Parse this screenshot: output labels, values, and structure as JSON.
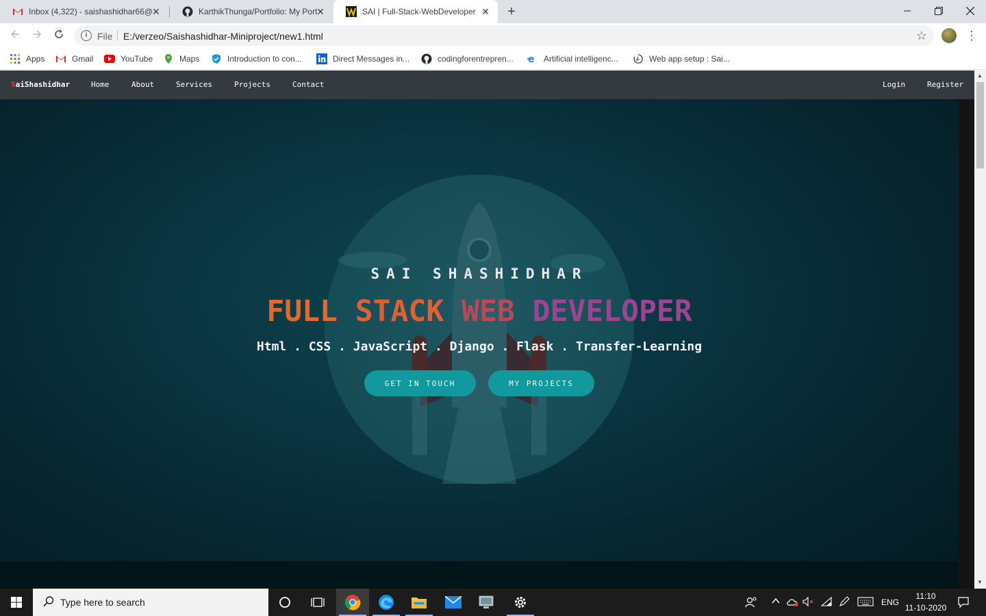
{
  "browser": {
    "tabs": [
      {
        "title": "Inbox (4,322) - saishashidhar66@",
        "icon": "gmail-icon"
      },
      {
        "title": "KarthikThunga/Portfolio: My Port",
        "icon": "github-icon"
      },
      {
        "title": "SAI | Full-Stack-WebDeveloper",
        "icon": "site-icon",
        "active": true
      }
    ],
    "new_tab": "+",
    "address": {
      "scheme": "File",
      "url": "E:/verzeo/Saishashidhar-Miniproject/new1.html"
    },
    "bookmarks": [
      {
        "label": "Apps",
        "icon": "apps-grid-icon"
      },
      {
        "label": "Gmail",
        "icon": "gmail-icon"
      },
      {
        "label": "YouTube",
        "icon": "youtube-icon"
      },
      {
        "label": "Maps",
        "icon": "maps-icon"
      },
      {
        "label": "Introduction to con...",
        "icon": "shield-icon"
      },
      {
        "label": "Direct Messages in...",
        "icon": "linkedin-icon"
      },
      {
        "label": "codingforentrepren...",
        "icon": "github-icon"
      },
      {
        "label": "Artificial intelligenc...",
        "icon": "edge-icon"
      },
      {
        "label": "Web app setup : Sai...",
        "icon": "loading-icon"
      }
    ]
  },
  "site": {
    "brand_first": "S",
    "brand_rest": "aiShashidhar",
    "nav": [
      "Home",
      "About",
      "Services",
      "Projects",
      "Contact"
    ],
    "auth": [
      "Login",
      "Register"
    ],
    "hero": {
      "name": "SAI SHASHIDHAR",
      "title_words": [
        "FULL",
        "STACK",
        "WEB",
        "DEVELOPER"
      ],
      "skills": "Html . CSS . JavaScript . Django . Flask . Transfer-Learning",
      "buttons": [
        "GET IN TOUCH",
        "MY PROJECTS"
      ]
    }
  },
  "taskbar": {
    "search_placeholder": "Type here to search",
    "language": "ENG",
    "time": "11:10",
    "date": "11-10-2020"
  }
}
